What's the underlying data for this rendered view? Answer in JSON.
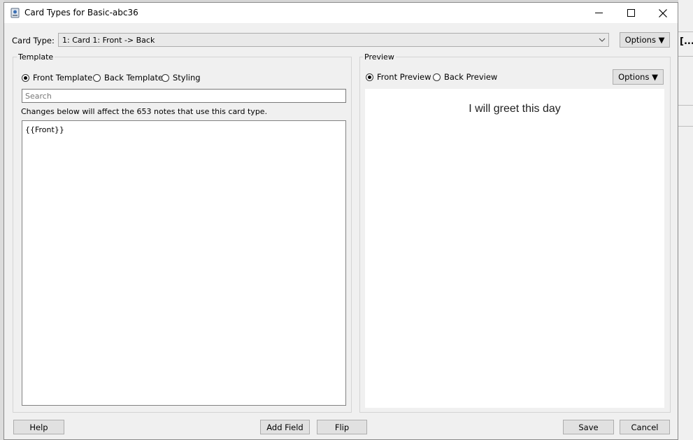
{
  "window": {
    "title": "Card Types for Basic-abc36"
  },
  "card_type": {
    "label": "Card Type:",
    "value": "1: Card 1: Front -> Back",
    "options_label": "Options ▼"
  },
  "template": {
    "group_label": "Template",
    "radios": [
      {
        "label": "Front Template",
        "checked": true
      },
      {
        "label": "Back Template",
        "checked": false
      },
      {
        "label": "Styling",
        "checked": false
      }
    ],
    "search_placeholder": "Search",
    "info": "Changes below will affect the 653 notes that use this card type.",
    "content": "{{Front}}"
  },
  "preview": {
    "group_label": "Preview",
    "radios": [
      {
        "label": "Front Preview",
        "checked": true
      },
      {
        "label": "Back Preview",
        "checked": false
      }
    ],
    "options_label": "Options ▼",
    "card_text": "I will greet this day"
  },
  "footer": {
    "help": "Help",
    "add_field": "Add Field",
    "flip": "Flip",
    "save": "Save",
    "cancel": "Cancel"
  },
  "background": {
    "right_fragment_text": "[...]"
  }
}
